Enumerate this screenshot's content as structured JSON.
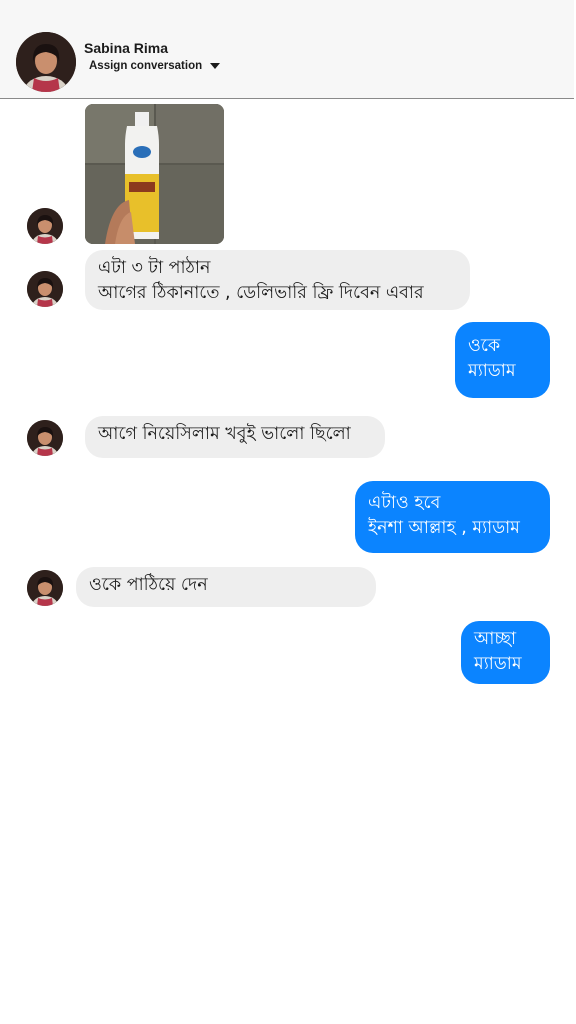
{
  "header": {
    "contact_name": "Sabina Rima",
    "assign_label": "Assign conversation"
  },
  "messages": [
    {
      "id": 1,
      "from": "contact",
      "type": "image",
      "description_icon": "product-bottle-photo"
    },
    {
      "id": 2,
      "from": "contact",
      "lines": [
        "এটা ৩ টা পাঠান",
        "আগের ঠিকানাতে , ডেলিভারি ফ্রি দিবেন এবার"
      ]
    },
    {
      "id": 3,
      "from": "me",
      "lines": [
        "ওকে",
        "ম্যাডাম"
      ]
    },
    {
      "id": 4,
      "from": "contact",
      "lines": [
        "আগে নিয়েসিলাম খবুই ভালো ছিলো"
      ]
    },
    {
      "id": 5,
      "from": "me",
      "lines": [
        "এটাও হবে",
        "ইনশা আল্লাহ , ম্যাডাম"
      ]
    },
    {
      "id": 6,
      "from": "contact",
      "lines": [
        "ওকে পাঠিয়ে দেন"
      ]
    },
    {
      "id": 7,
      "from": "me",
      "lines": [
        "আচ্ছা",
        "ম্যাডাম"
      ]
    }
  ],
  "colors": {
    "outgoing_bubble": "#0b84ff",
    "incoming_bubble": "#eeeeee",
    "header_bg": "#f7f7f7"
  }
}
